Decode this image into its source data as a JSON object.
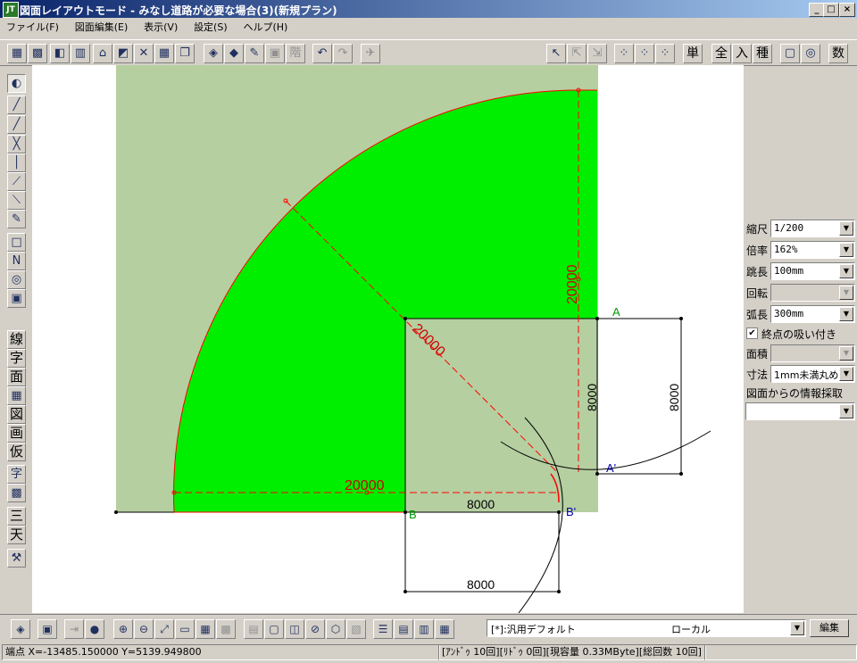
{
  "window": {
    "title": "図面レイアウトモード - みなし道路が必要な場合(3)(新規プラン)",
    "app_icon": "JT",
    "minimize": "_",
    "restore": "□",
    "close": "×"
  },
  "menu": [
    "ファイル(F)",
    "図面編集(E)",
    "表示(V)",
    "設定(S)",
    "ヘルプ(H)"
  ],
  "toolbar": {
    "right_text_buttons": [
      "単",
      "全",
      "入",
      "種",
      "数"
    ]
  },
  "left_toolbar": {
    "text_buttons": [
      "線",
      "字",
      "面",
      "図",
      "画",
      "仮",
      "三",
      "天"
    ]
  },
  "drawing": {
    "dim_labels": {
      "arc_radius": "20000",
      "vertical_radius": "20000",
      "horizontal_radius": "20000",
      "vertical_8000_left": "8000",
      "vertical_8000_right": "8000",
      "horizontal_8000_top": "8000",
      "horizontal_8000_bottom": "8000"
    },
    "point_labels": {
      "A": "A",
      "A_prime": "A'",
      "B": "B",
      "B_prime": "B'"
    },
    "colors": {
      "road_fill": "#00ee00",
      "site_fill": "#b5cfa0",
      "red_line": "#ff0000",
      "dim_text": "#d00000",
      "blue_label": "#0000aa",
      "green_label": "#009900"
    }
  },
  "right_panel": {
    "scale_label": "縮尺",
    "scale_value": "1/200",
    "zoom_label": "倍率",
    "zoom_value": "162%",
    "jump_label": "跳長",
    "jump_value": "100mm",
    "rotate_label": "回転",
    "rotate_value": "",
    "arc_label": "弧長",
    "arc_value": "300mm",
    "snap_checkbox_label": "終点の吸い付き",
    "snap_checked": true,
    "area_label": "面積",
    "area_value": "",
    "dim_label": "寸法",
    "dim_value": "1mm未満丸め",
    "info_label": "図面からの情報採取",
    "info_value": ""
  },
  "bottom_bar": {
    "layer_name": "[*]:汎用デフォルト",
    "layer_scope": "ローカル",
    "edit_button": "編集"
  },
  "status": {
    "coords": "端点 X=-13485.150000 Y=5139.949800",
    "info": "[ｱﾝﾄﾞｩ 10回][ﾘﾄﾞｩ 0回][現容量 0.33MByte][総回数 10回]"
  }
}
